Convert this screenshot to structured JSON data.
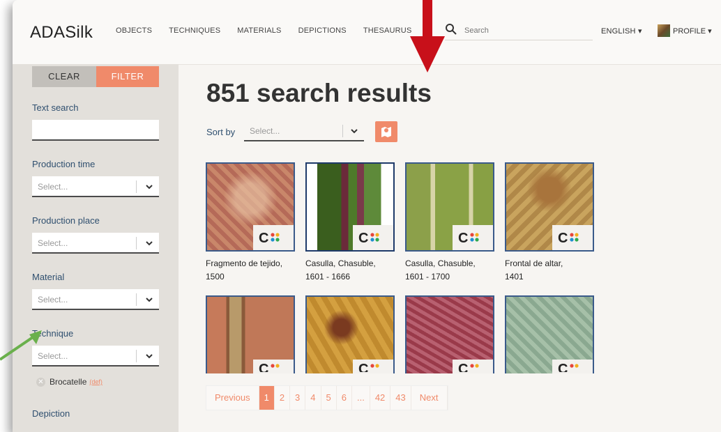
{
  "header": {
    "brand": "ADASilk",
    "nav": [
      "OBJECTS",
      "TECHNIQUES",
      "MATERIALS",
      "DEPICTIONS",
      "THESAURUS"
    ],
    "search_placeholder": "Search",
    "language": "ENGLISH ▾",
    "profile": "PROFILE ▾"
  },
  "sidebar": {
    "clear_label": "CLEAR",
    "filter_label": "FILTER",
    "text_search_label": "Text search",
    "production_time_label": "Production time",
    "production_place_label": "Production place",
    "material_label": "Material",
    "technique_label": "Technique",
    "depiction_label": "Depiction",
    "select_placeholder": "Select...",
    "active_filter": {
      "label": "Brocatelle",
      "def": "(def)"
    }
  },
  "main": {
    "title": "851 search results",
    "sort_label": "Sort by",
    "sort_placeholder": "Select..."
  },
  "results": [
    {
      "line1": "Fragmento de tejido,",
      "line2": "1500"
    },
    {
      "line1": "Casulla, Chasuble,",
      "line2": "1601 - 1666"
    },
    {
      "line1": "Casulla, Chasuble,",
      "line2": "1601 - 1700"
    },
    {
      "line1": "Frontal de altar,",
      "line2": "1401"
    }
  ],
  "pagination": [
    "Previous",
    "1",
    "2",
    "3",
    "4",
    "5",
    "6",
    "...",
    "42",
    "43",
    "Next"
  ],
  "colors": {
    "accent": "#f08a6a",
    "label_blue": "#2f4f6f",
    "annotation_red": "#c8101a",
    "annotation_green": "#6ab04c"
  }
}
